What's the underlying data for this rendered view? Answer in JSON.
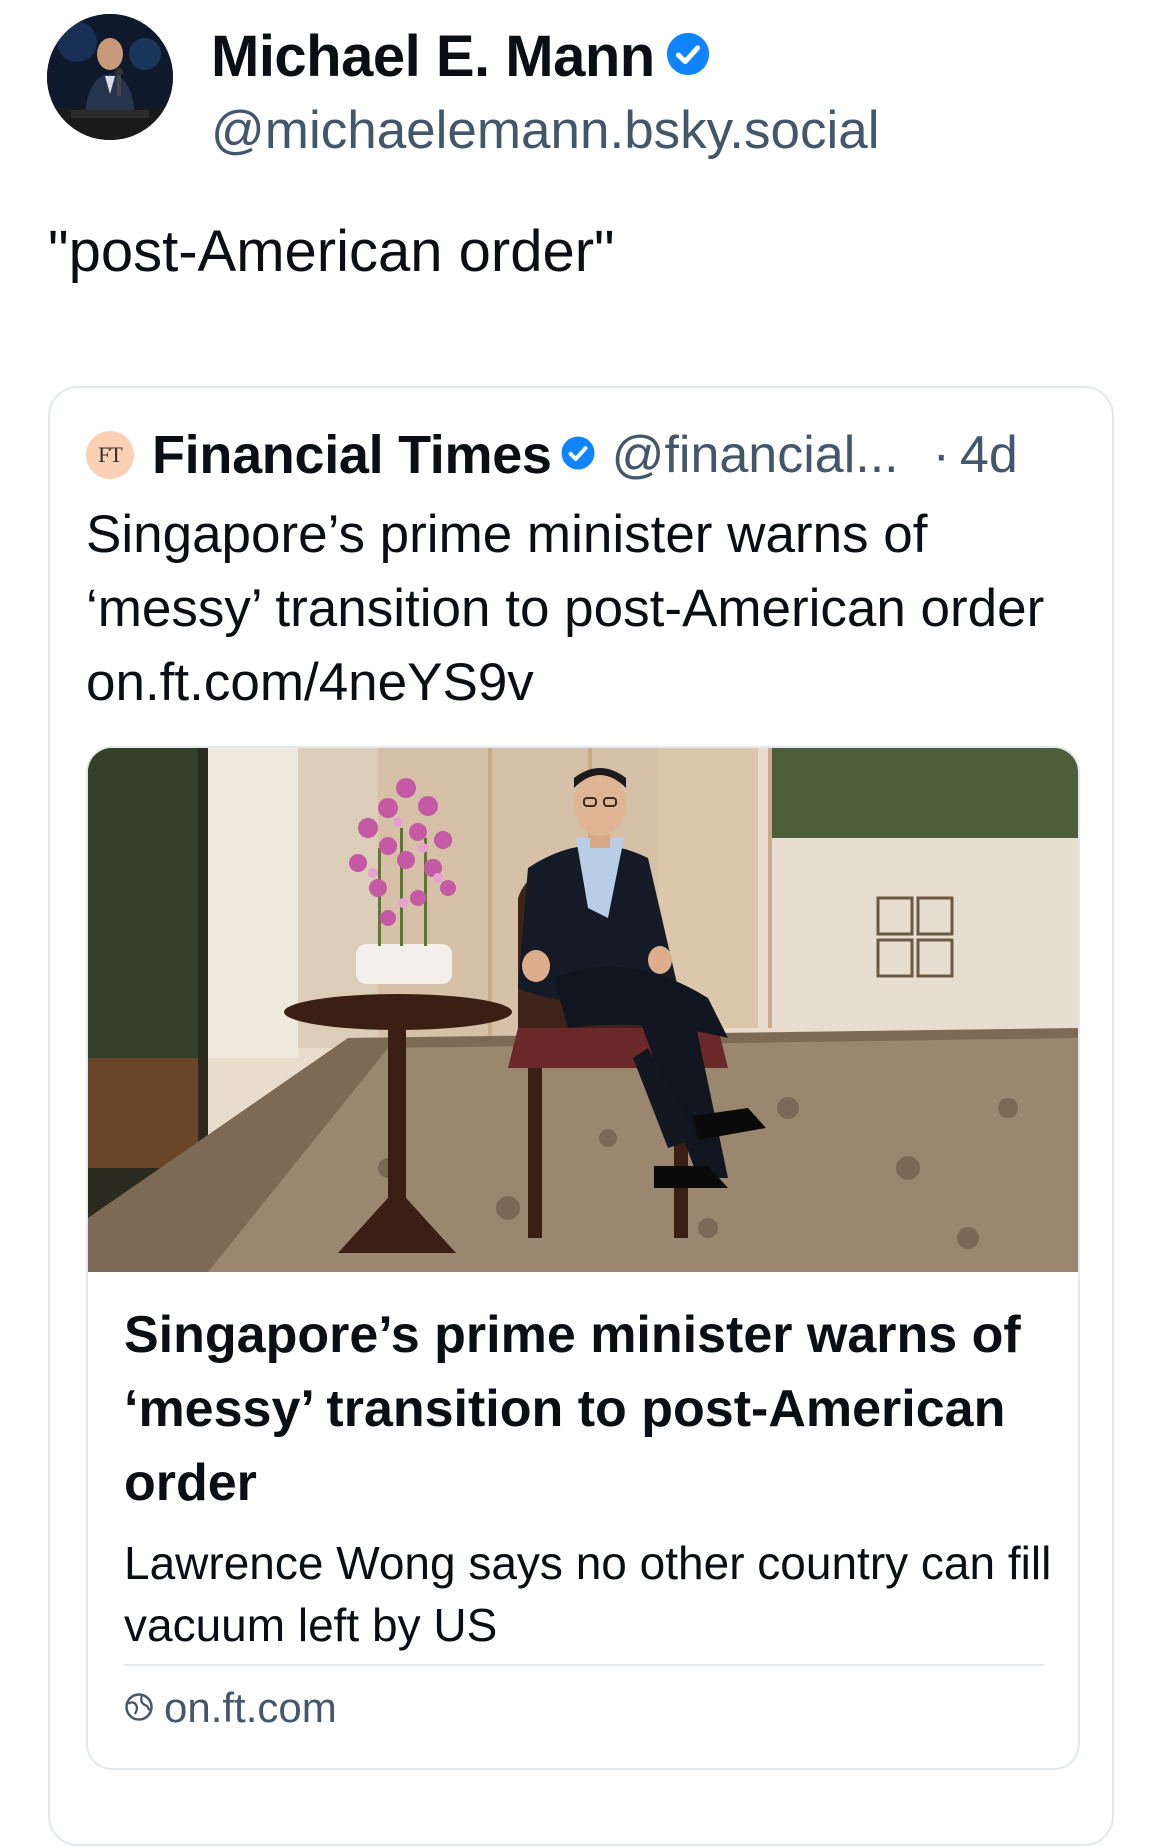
{
  "post": {
    "author_name": "Michael E. Mann",
    "author_handle": "@michaelemann.bsky.social",
    "text": "\"post-American order\""
  },
  "quote": {
    "logo_text": "FT",
    "name": "Financial Times",
    "handle": "@financial...",
    "separator": "·",
    "time": "4d",
    "text": "Singapore’s prime minister warns of ‘messy’ transition to post-American order on.ft.com/4neYS9v"
  },
  "link_card": {
    "title": "Singapore’s prime minister warns of ‘messy’ transition to post-American order",
    "description": "Lawrence Wong says no other country can fill vacuum left by US",
    "domain": "on.ft.com"
  },
  "icons": {
    "verified": "verified-badge-icon",
    "globe": "globe-icon"
  },
  "colors": {
    "accent": "#1083fe",
    "secondary_text": "#42576c",
    "border": "#e3e8ee",
    "ft_logo_bg": "#fcd0b4"
  }
}
